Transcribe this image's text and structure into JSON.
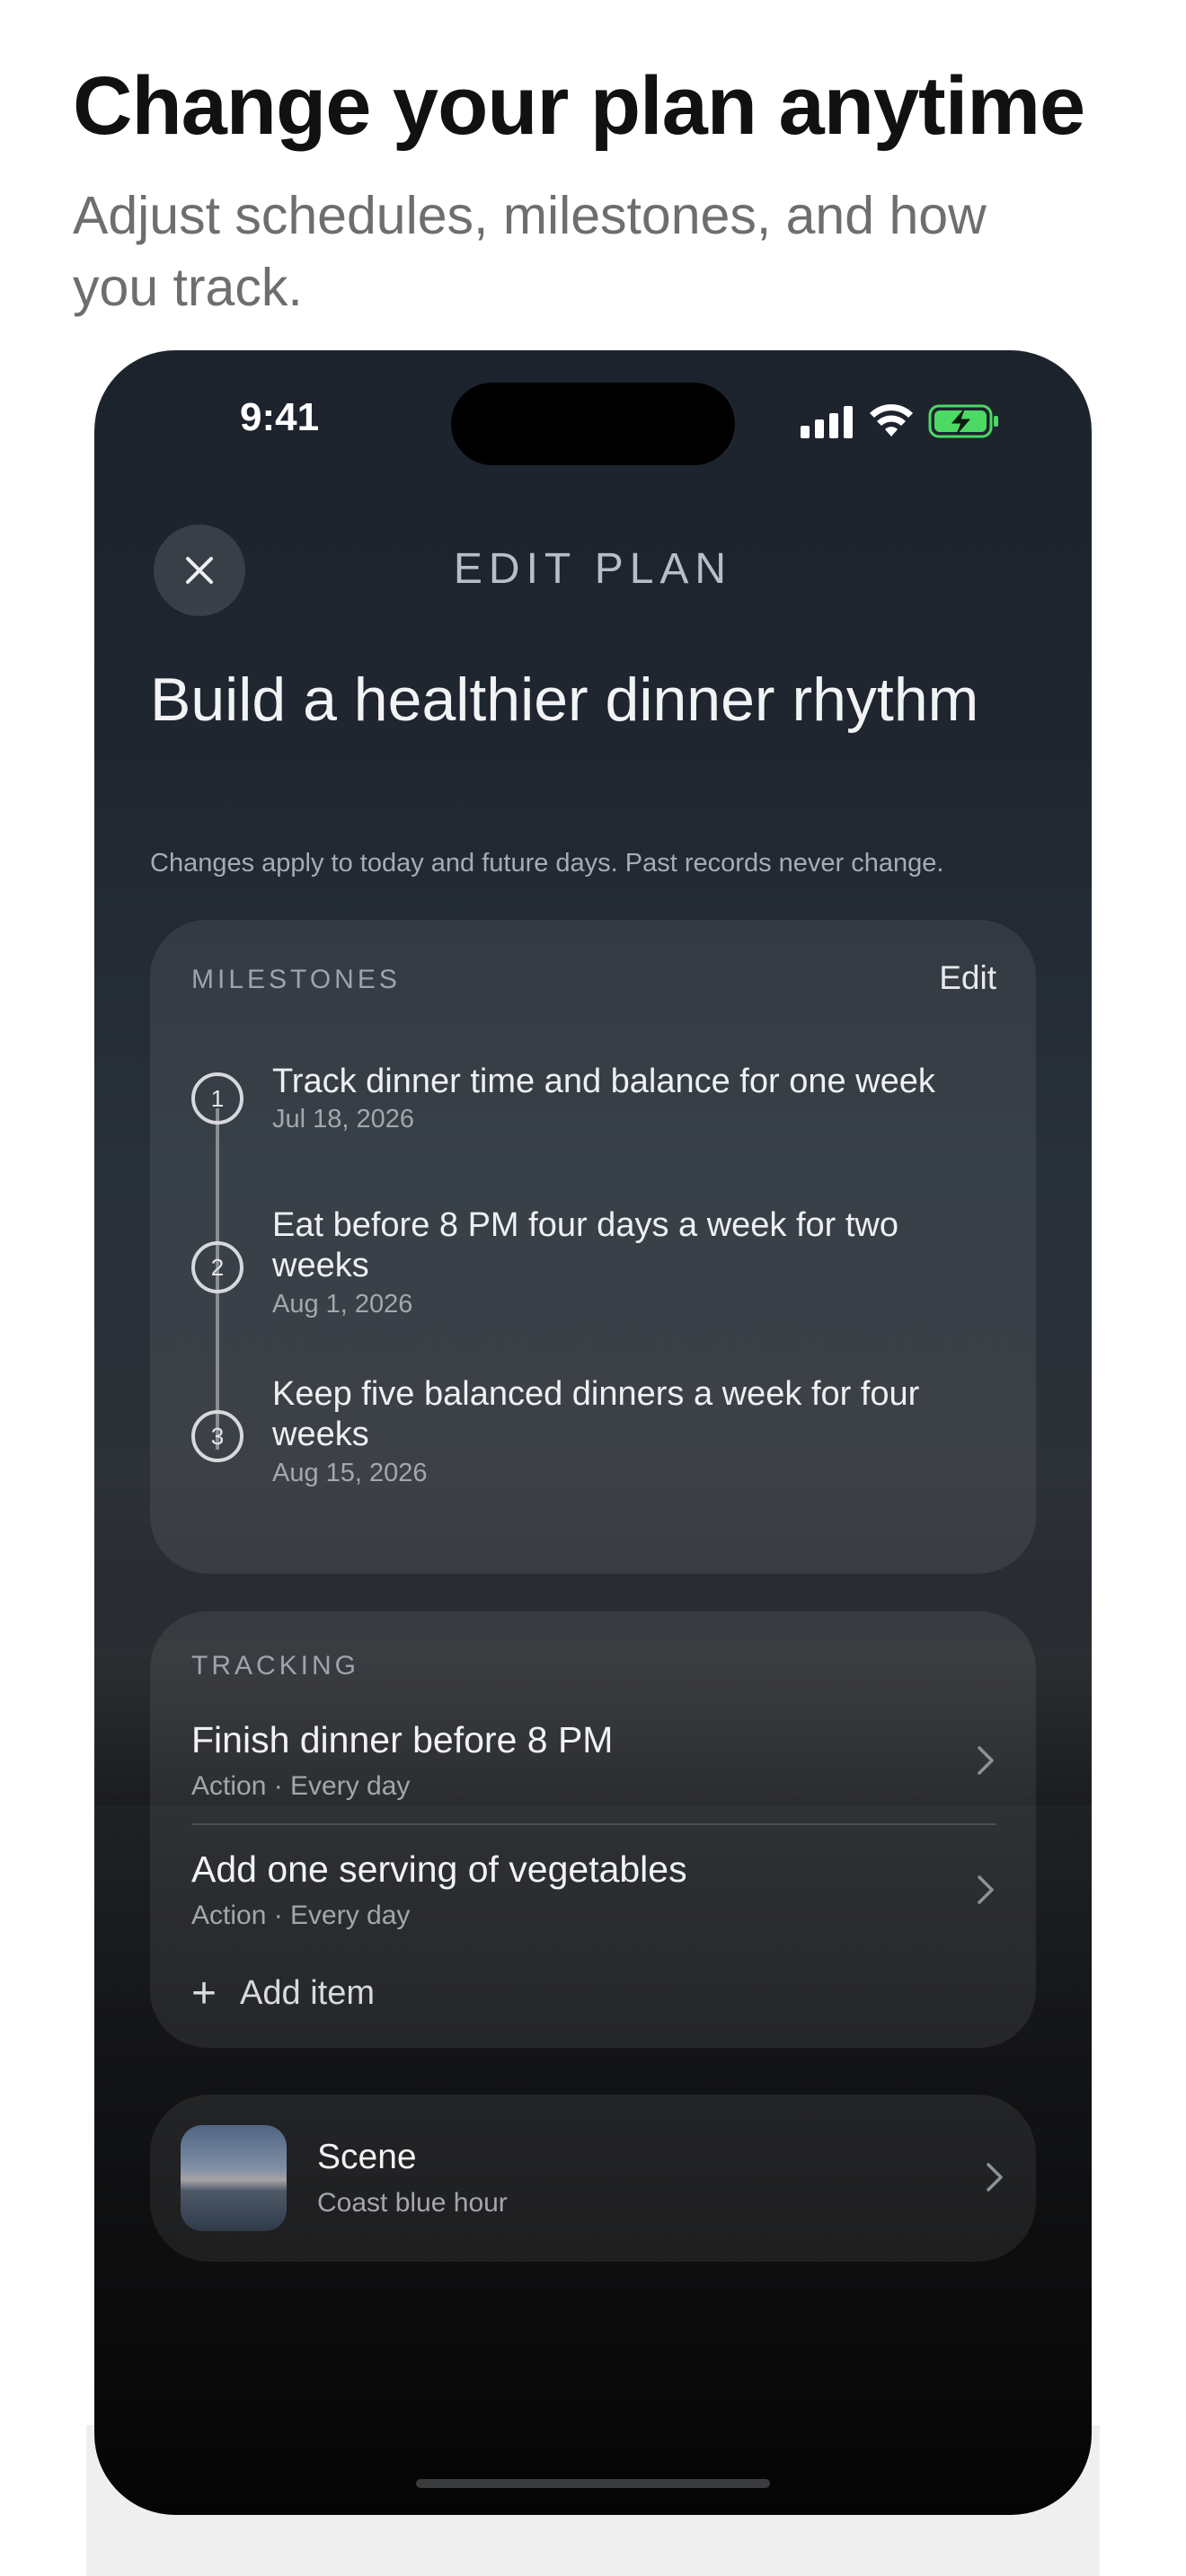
{
  "promo": {
    "headline": "Change your plan anytime",
    "subhead": "Adjust schedules, milestones, and how you track."
  },
  "status_bar": {
    "time": "9:41",
    "icons": [
      "signal-icon",
      "wifi-icon",
      "battery-charging-icon"
    ]
  },
  "header": {
    "close_icon": "close-icon",
    "title": "EDIT PLAN"
  },
  "plan": {
    "title": "Build a healthier dinner rhythm",
    "note": "Changes apply to today and future days. Past records never change."
  },
  "milestones": {
    "label": "MILESTONES",
    "edit_label": "Edit",
    "items": [
      {
        "number": "1",
        "title": "Track dinner time and balance for one week",
        "date": "Jul 18, 2026"
      },
      {
        "number": "2",
        "title": "Eat before 8 PM four days a week for two weeks",
        "date": "Aug 1, 2026"
      },
      {
        "number": "3",
        "title": "Keep five balanced dinners a week for four weeks",
        "date": "Aug 15, 2026"
      }
    ]
  },
  "tracking": {
    "label": "TRACKING",
    "items": [
      {
        "title": "Finish dinner before 8 PM",
        "subtitle": "Action · Every day"
      },
      {
        "title": "Add one serving of vegetables",
        "subtitle": "Action · Every day"
      }
    ],
    "add_label": "Add item"
  },
  "scene": {
    "title": "Scene",
    "subtitle": "Coast blue hour"
  },
  "colors": {
    "background_top": "#1d232c",
    "background_bottom": "#050505",
    "battery_green": "#4cd964",
    "card_fill": "rgba(255,255,255,0.08)"
  }
}
